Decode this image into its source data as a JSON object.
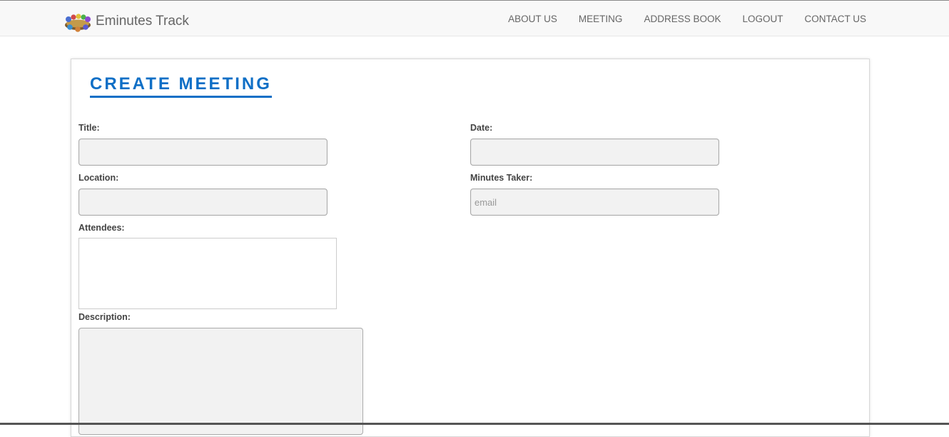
{
  "navbar": {
    "brand": "Eminutes Track",
    "links": [
      "ABOUT US",
      "MEETING",
      "ADDRESS BOOK",
      "LOGOUT",
      "CONTACT US"
    ]
  },
  "form": {
    "heading": "CREATE MEETING",
    "title_label": "Title:",
    "title_value": "",
    "date_label": "Date:",
    "date_value": "",
    "location_label": "Location:",
    "location_value": "",
    "minutes_taker_label": "Minutes Taker:",
    "minutes_taker_placeholder": "email",
    "attendees_label": "Attendees:",
    "description_label": "Description:"
  },
  "colors": {
    "accent": "#0f6fc6",
    "navbar_bg": "#f8f8f8",
    "input_bg": "#f2f2f2"
  }
}
